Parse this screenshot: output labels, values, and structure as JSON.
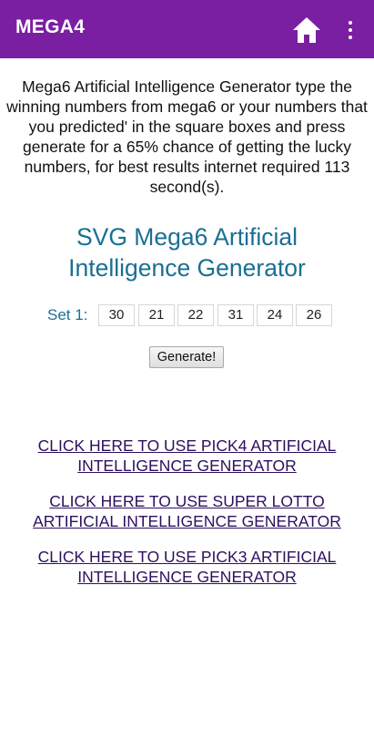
{
  "appbar": {
    "title": "MEGA4",
    "home_icon": "home-icon",
    "menu_icon": "more-vert-icon"
  },
  "colors": {
    "appbar": "#7b1fa2",
    "heading": "#1a6f94",
    "link": "#2d0f5f"
  },
  "intro": {
    "text": "Mega6 Artificial Intelligence Generator type the winning numbers from mega6 or your numbers that you predicted' in the square boxes and press generate for a 65% chance of getting the lucky numbers, for best results internet required 113 second(s)."
  },
  "generator": {
    "title": "SVG Mega6 Artificial Intelligence Generator",
    "set_label": "Set 1:",
    "numbers": [
      "30",
      "21",
      "22",
      "31",
      "24",
      "26"
    ],
    "button_label": "Generate!"
  },
  "links": [
    {
      "text": "CLICK HERE TO USE PICK4 ARTIFICIAL INTELLIGENCE GENERATOR"
    },
    {
      "text": "CLICK HERE TO USE SUPER LOTTO ARTIFICIAL INTELLIGENCE GENERATOR"
    },
    {
      "text": "CLICK HERE TO USE PICK3 ARTIFICIAL INTELLIGENCE GENERATOR"
    }
  ]
}
